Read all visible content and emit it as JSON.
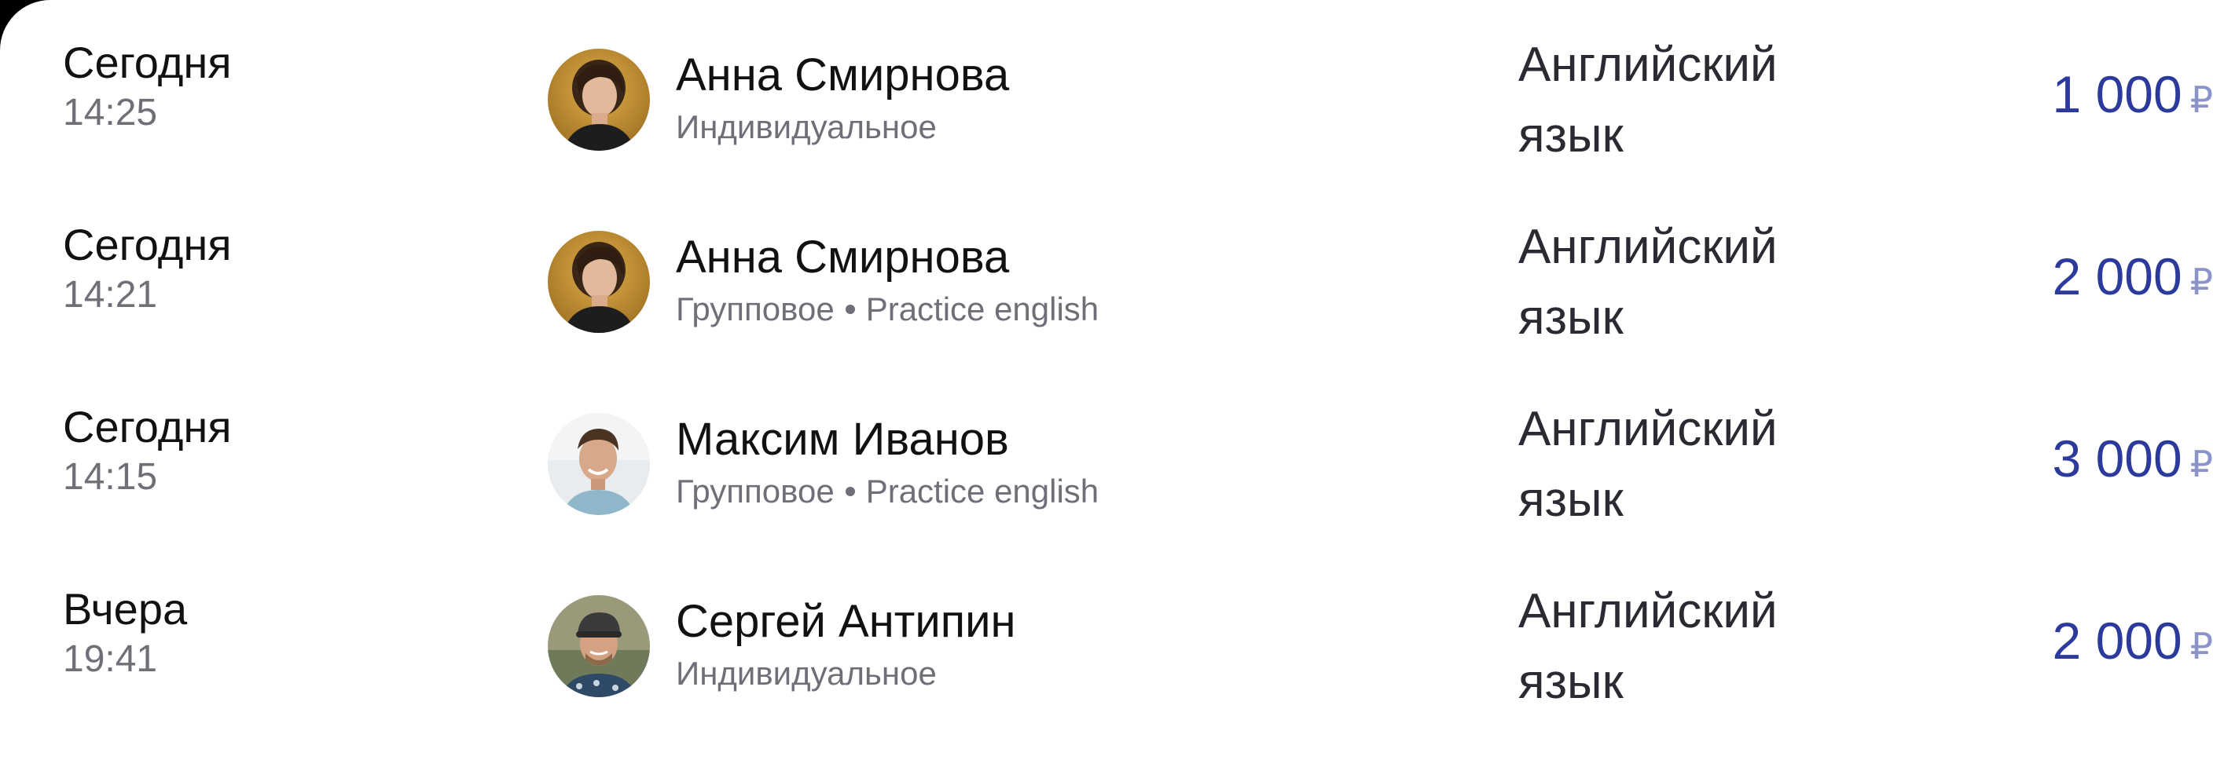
{
  "payments": [
    {
      "date": "Сегодня",
      "time": "14:25",
      "student": "Анна Смирнова",
      "lesson_type": "Индивидуальное",
      "group": "",
      "subject": "Английский язык",
      "amount": "1 000",
      "currency": "₽",
      "avatar": "woman-curly-hair-avatar"
    },
    {
      "date": "Сегодня",
      "time": "14:21",
      "student": "Анна Смирнова",
      "lesson_type": "Групповое",
      "group": "Practice english",
      "subject": "Английский язык",
      "amount": "2 000",
      "currency": "₽",
      "avatar": "woman-curly-hair-avatar"
    },
    {
      "date": "Сегодня",
      "time": "14:15",
      "student": "Максим Иванов",
      "lesson_type": "Групповое",
      "group": "Practice english",
      "subject": "Английский язык",
      "amount": "3 000",
      "currency": "₽",
      "avatar": "man-smiling-avatar"
    },
    {
      "date": "Вчера",
      "time": "19:41",
      "student": "Сергей Антипин",
      "lesson_type": "Индивидуальное",
      "group": "",
      "subject": "Английский язык",
      "amount": "2 000",
      "currency": "₽",
      "avatar": "man-cap-avatar"
    }
  ],
  "colors": {
    "amount": "#2b3a9b",
    "currency": "#8a94c8",
    "secondary_text": "#6f6f78",
    "primary_text": "#111111"
  }
}
